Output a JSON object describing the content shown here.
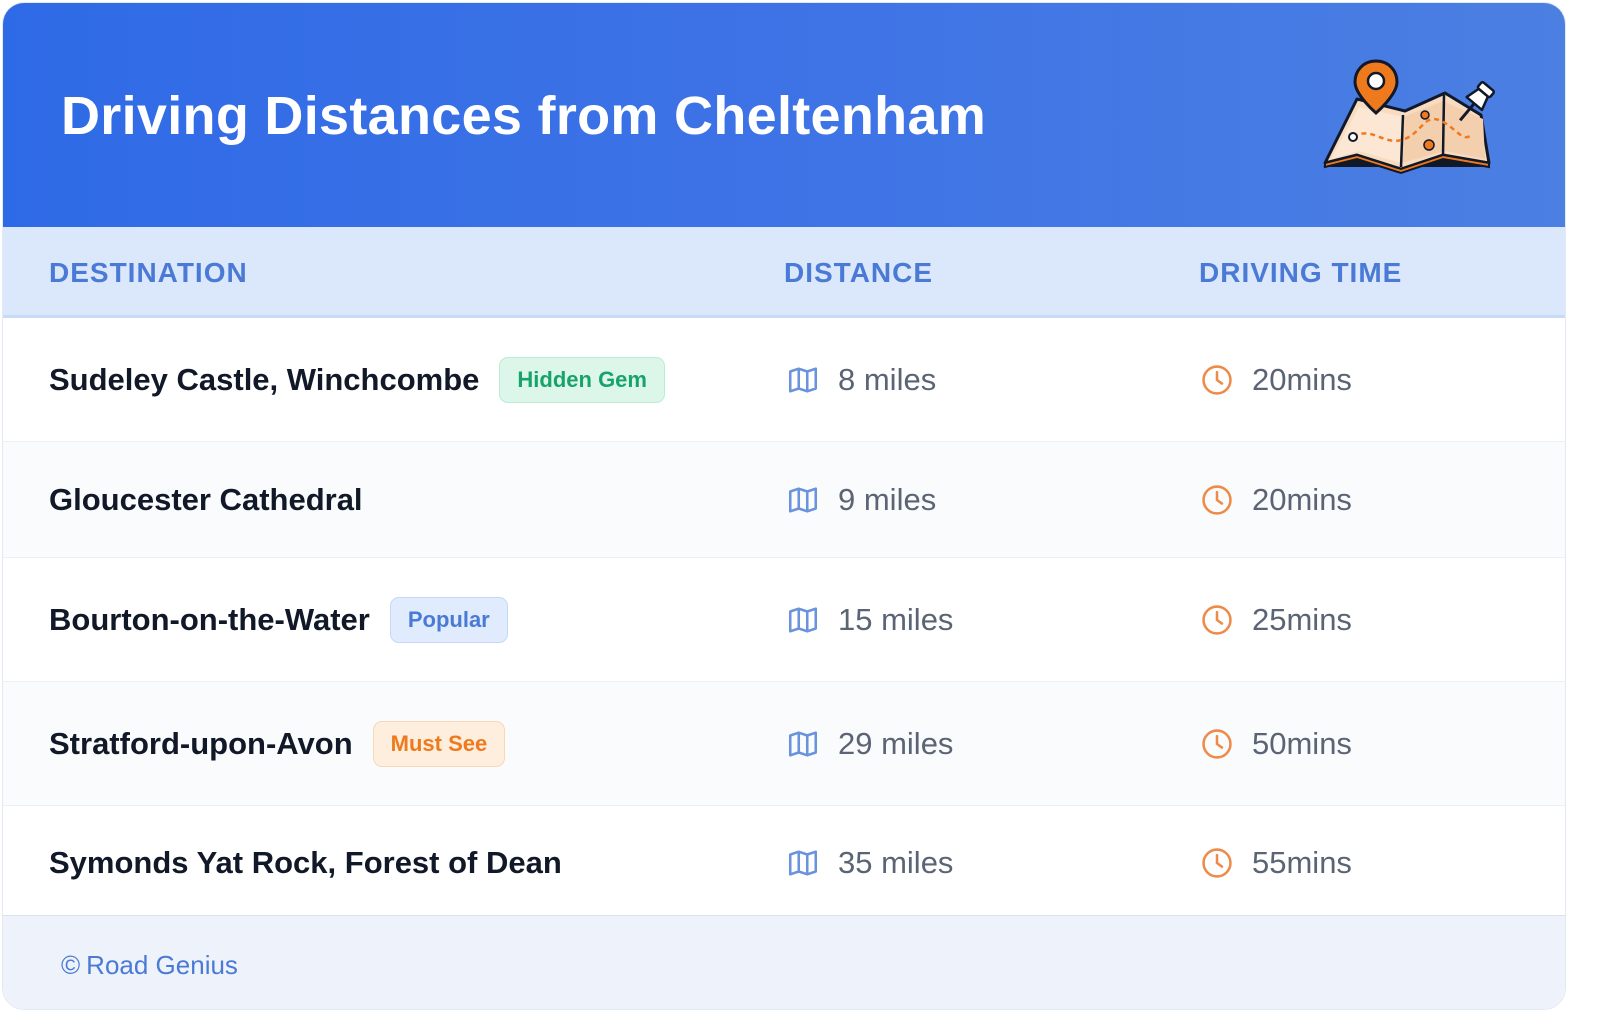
{
  "header": {
    "title": "Driving Distances from Cheltenham",
    "illustration_icon": "map-with-pins-icon"
  },
  "columns": {
    "destination": "DESTINATION",
    "distance": "DISTANCE",
    "driving_time": "DRIVING TIME"
  },
  "rows": [
    {
      "destination": "Sudeley Castle, Winchcombe",
      "badge": "Hidden Gem",
      "badge_color": "#18a36b",
      "distance": "8 miles",
      "time": "20mins"
    },
    {
      "destination": "Gloucester Cathedral",
      "badge": "",
      "distance": "9 miles",
      "time": "20mins"
    },
    {
      "destination": "Bourton-on-the-Water",
      "badge": "Popular",
      "badge_color": "#4a7ad6",
      "distance": "15 miles",
      "time": "25mins"
    },
    {
      "destination": "Stratford-upon-Avon",
      "badge": "Must See",
      "badge_color": "#ef7a1e",
      "distance": "29 miles",
      "time": "50mins"
    },
    {
      "destination": "Symonds Yat Rock, Forest of Dean",
      "badge": "",
      "distance": "35 miles",
      "time": "55mins"
    }
  ],
  "icons": {
    "distance": "map-icon",
    "time": "clock-icon"
  },
  "footer": {
    "copyright_symbol": "©",
    "brand": "Road Genius"
  },
  "colors": {
    "header_bg": "#2f6ae6",
    "accent_blue": "#4a7ad6",
    "accent_orange": "#ef7a1e",
    "accent_green": "#18a36b"
  }
}
